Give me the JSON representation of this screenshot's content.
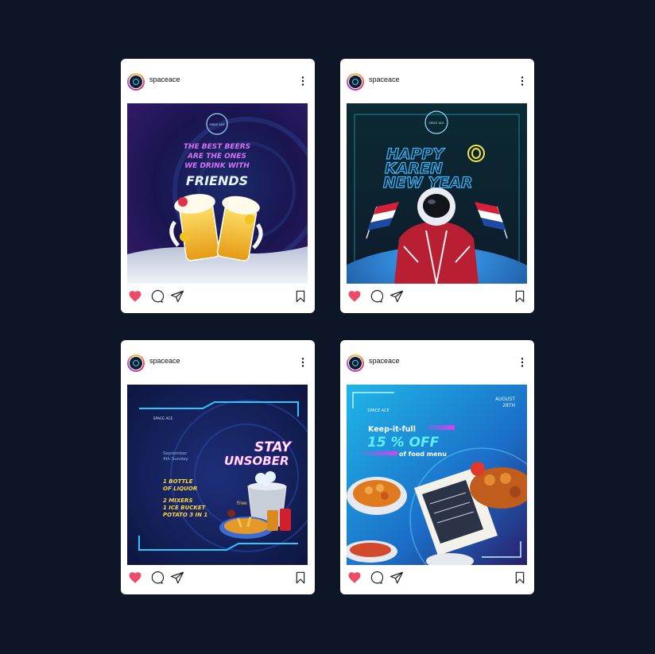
{
  "colors": {
    "background": "#0d1627",
    "card": "#ffffff",
    "like": "#ed4b68",
    "accent_cyan": "#38d7ff",
    "accent_magenta": "#e13ef3"
  },
  "posts": [
    {
      "username": "spaceace",
      "image": {
        "logo_text": "SPACE ACE",
        "line1": "THE BEST BEERS",
        "line2": "ARE THE ONES",
        "line3": "WE DRINK WITH",
        "headline": "FRIENDS"
      },
      "liked": true,
      "icons": [
        "heart-icon",
        "comment-icon",
        "share-icon",
        "bookmark-icon"
      ]
    },
    {
      "username": "spaceace",
      "image": {
        "logo_text": "SPACE ACE",
        "line1": "HAPPY",
        "line2": "KAREN",
        "line3": "NEW YEAR"
      },
      "liked": true,
      "icons": [
        "heart-icon",
        "comment-icon",
        "share-icon",
        "bookmark-icon"
      ]
    },
    {
      "username": "spaceace",
      "image": {
        "logo_text": "SPACE ACE",
        "date_line1": "September",
        "date_line2": "4th Sunday",
        "headline1": "STAY",
        "headline2": "UNSOBER",
        "offer1": "1 BOTTLE",
        "offer2": "OF LIQUOR",
        "offer3": "2 MIXERS",
        "offer4": "1 ICE BUCKET",
        "offer5": "POTATO 3 IN 1",
        "free_label": "Free"
      },
      "liked": true,
      "icons": [
        "heart-icon",
        "comment-icon",
        "share-icon",
        "bookmark-icon"
      ]
    },
    {
      "username": "spaceace",
      "image": {
        "logo_text": "SPACE ACE",
        "date_line1": "AUGUST",
        "date_line2": "28TH",
        "tagline": "Keep-it-full",
        "headline": "15 % OFF",
        "sub": "of food menu"
      },
      "liked": true,
      "icons": [
        "heart-icon",
        "comment-icon",
        "share-icon",
        "bookmark-icon"
      ]
    }
  ]
}
